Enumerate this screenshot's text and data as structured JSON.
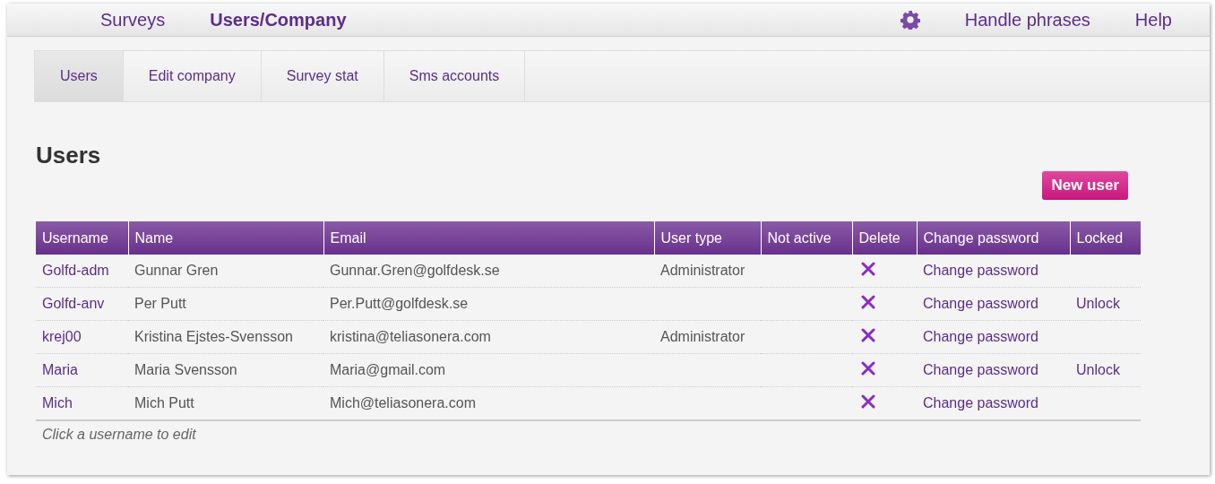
{
  "nav": {
    "items": [
      {
        "label": "Surveys",
        "selected": false
      },
      {
        "label": "Users/Company",
        "selected": true
      }
    ],
    "right": [
      {
        "label": "Handle phrases"
      },
      {
        "label": "Help"
      }
    ]
  },
  "tabs": [
    {
      "label": "Users",
      "selected": true
    },
    {
      "label": "Edit company",
      "selected": false
    },
    {
      "label": "Survey stat",
      "selected": false
    },
    {
      "label": "Sms accounts",
      "selected": false
    }
  ],
  "heading": "Users",
  "new_user_button": "New user",
  "table": {
    "columns": [
      "Username",
      "Name",
      "Email",
      "User type",
      "Not active",
      "Delete",
      "Change password",
      "Locked"
    ],
    "rows": [
      {
        "username": "Golfd-adm",
        "name": "Gunnar Gren",
        "email": "Gunnar.Gren@golfdesk.se",
        "user_type": "Administrator",
        "change_password": "Change password"
      },
      {
        "username": "Golfd-anv",
        "name": "Per Putt",
        "email": "Per.Putt@golfdesk.se",
        "change_password": "Change password",
        "locked": "Unlock"
      },
      {
        "username": "krej00",
        "name": "Kristina Ejstes-Svensson",
        "email": "kristina@teliasonera.com",
        "user_type": "Administrator",
        "change_password": "Change password"
      },
      {
        "username": "Maria",
        "name": "Maria Svensson",
        "email": "Maria@gmail.com",
        "change_password": "Change password",
        "locked": "Unlock"
      },
      {
        "username": "Mich",
        "name": "Mich Putt",
        "email": "Mich@teliasonera.com",
        "change_password": "Change password"
      }
    ]
  },
  "hint": "Click a username to edit"
}
